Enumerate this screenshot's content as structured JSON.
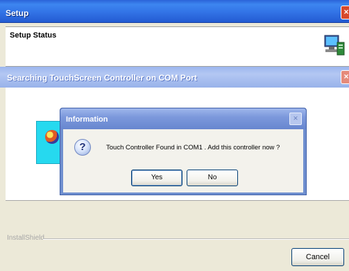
{
  "setup_window": {
    "title": "Setup",
    "close_glyph": "×",
    "status_label": "Setup Status",
    "status_icon": "computer-setup-icon"
  },
  "search_window": {
    "title": "Searching TouchScreen Controller on COM Port",
    "close_glyph": "×",
    "graphic_icon": "touchscreen-graphic-icon"
  },
  "info_dialog": {
    "title": "Information",
    "close_glyph": "×",
    "icon": "question-icon",
    "icon_glyph": "?",
    "message": "Touch Controller Found in COM1 . Add this controller now ?",
    "yes_label": "Yes",
    "no_label": "No"
  },
  "footer": {
    "installshield_label": "InstallShield",
    "cancel_label": "Cancel"
  },
  "colors": {
    "titlebar_active": "#3273e6",
    "titlebar_inactive": "#b3c7f3",
    "dialog_frame": "#6f8fcf",
    "graphic_cyan": "#26d9ef"
  }
}
